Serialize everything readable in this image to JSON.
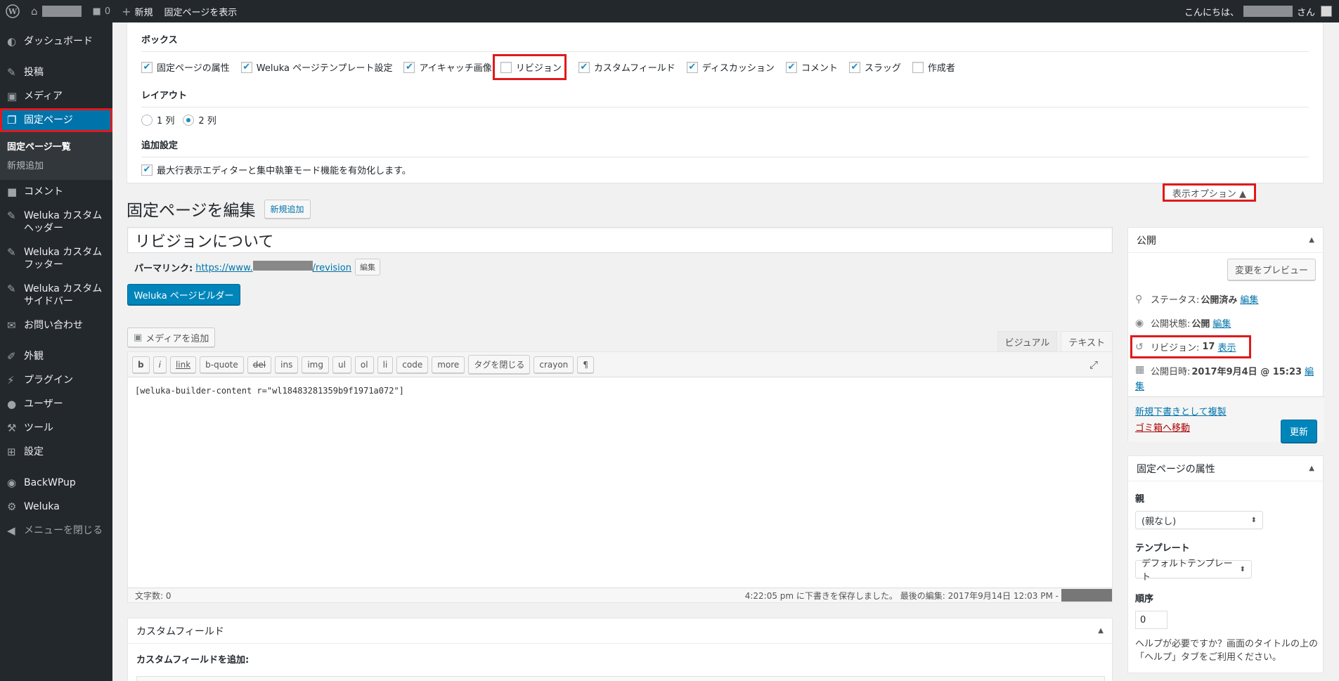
{
  "adminbar": {
    "comment_count": "0",
    "new_label": "新規",
    "view_page_label": "固定ページを表示",
    "greeting": "こんにちは、",
    "greeting_suffix": "さん"
  },
  "sidebar": {
    "items": [
      {
        "label": "ダッシュボード",
        "icon": "dashboard-icon"
      },
      {
        "label": "投稿",
        "icon": "pin-icon"
      },
      {
        "label": "メディア",
        "icon": "media-icon"
      },
      {
        "label": "固定ページ",
        "icon": "pages-icon"
      },
      {
        "label": "コメント",
        "icon": "comment-icon"
      },
      {
        "label": "Weluka カスタムヘッダー",
        "icon": "pin-icon"
      },
      {
        "label": "Weluka カスタムフッター",
        "icon": "pin-icon"
      },
      {
        "label": "Weluka カスタムサイドバー",
        "icon": "pin-icon"
      },
      {
        "label": "お問い合わせ",
        "icon": "mail-icon"
      },
      {
        "label": "外観",
        "icon": "appearance-icon"
      },
      {
        "label": "プラグイン",
        "icon": "plugin-icon"
      },
      {
        "label": "ユーザー",
        "icon": "user-icon"
      },
      {
        "label": "ツール",
        "icon": "wrench-icon"
      },
      {
        "label": "設定",
        "icon": "settings-icon"
      },
      {
        "label": "BackWPup",
        "icon": "backwpup-icon"
      },
      {
        "label": "Weluka",
        "icon": "gear-icon"
      }
    ],
    "submenu": [
      "固定ページ一覧",
      "新規追加"
    ],
    "collapse_label": "メニューを閉じる"
  },
  "screen_options": {
    "boxes_heading": "ボックス",
    "boxes": [
      {
        "label": "固定ページの属性",
        "checked": true
      },
      {
        "label": "Weluka ページテンプレート設定",
        "checked": true
      },
      {
        "label": "アイキャッチ画像",
        "checked": true
      },
      {
        "label": "リビジョン",
        "checked": false
      },
      {
        "label": "カスタムフィールド",
        "checked": true
      },
      {
        "label": "ディスカッション",
        "checked": true
      },
      {
        "label": "コメント",
        "checked": true
      },
      {
        "label": "スラッグ",
        "checked": true
      },
      {
        "label": "作成者",
        "checked": false
      }
    ],
    "layout_heading": "レイアウト",
    "layout_options": [
      "1 列",
      "2 列"
    ],
    "layout_selected": "2 列",
    "additional_heading": "追加設定",
    "additional_option": "最大行表示エディターと集中執筆モード機能を有効化します。",
    "tab_label": "表示オプション ▲"
  },
  "page": {
    "heading": "固定ページを編集",
    "add_new": "新規追加",
    "title_value": "リビジョンについて",
    "permalink_label": "パーマリンク:",
    "permalink_prefix": "https://www.",
    "permalink_suffix": "/revision",
    "permalink_edit": "編集",
    "builder_button": "Weluka ページビルダー",
    "add_media": "メディアを追加",
    "tab_visual": "ビジュアル",
    "tab_text": "テキスト"
  },
  "editor": {
    "quicktags": [
      "b",
      "i",
      "link",
      "b-quote",
      "del",
      "ins",
      "img",
      "ul",
      "ol",
      "li",
      "code",
      "more",
      "タグを閉じる",
      "crayon",
      "¶"
    ],
    "content": "[weluka-builder-content r=\"wl18483281359b9f1971a072\"]",
    "word_count": "文字数: 0",
    "draft_saved": "4:22:05 pm に下書きを保存しました。 最後の編集: 2017年9月14日 12:03 PM -"
  },
  "custom_fields": {
    "title": "カスタムフィールド",
    "add_label": "カスタムフィールドを追加:"
  },
  "publish": {
    "title": "公開",
    "preview": "変更をプレビュー",
    "status_label": "ステータス:",
    "status_value": "公開済み",
    "visibility_label": "公開状態:",
    "visibility_value": "公開",
    "edit": "編集",
    "revisions_label": "リビジョン:",
    "revisions_count": "17",
    "revisions_link": "表示",
    "date_label": "公開日時:",
    "date_value": "2017年9月4日 @ 15:23",
    "date_edit_1": "編",
    "date_edit_2": "集",
    "duplicate": "新規下書きとして複製",
    "trash": "ゴミ箱へ移動",
    "update": "更新"
  },
  "attributes": {
    "title": "固定ページの属性",
    "parent_label": "親",
    "parent_value": "(親なし)",
    "template_label": "テンプレート",
    "template_value": "デフォルトテンプレート",
    "order_label": "順序",
    "order_value": "0",
    "help_text": "ヘルプが必要ですか？画面のタイトルの上の「ヘルプ」タブをご利用ください。"
  },
  "colors": {
    "accent": "#0073aa",
    "highlight": "#e0191b",
    "sidebar_bg": "#23282d"
  }
}
